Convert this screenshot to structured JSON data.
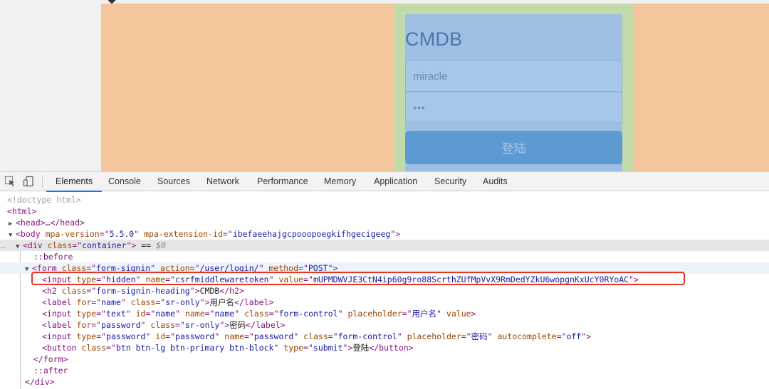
{
  "page": {
    "heading": "CMDB",
    "username_value": "miracle",
    "password_value": "•••",
    "login_button": "登陆"
  },
  "devtools": {
    "tabs": [
      {
        "label": "Elements",
        "active": true
      },
      {
        "label": "Console"
      },
      {
        "label": "Sources"
      },
      {
        "label": "Network"
      },
      {
        "label": "Performance"
      },
      {
        "label": "Memory"
      },
      {
        "label": "Application"
      },
      {
        "label": "Security"
      },
      {
        "label": "Audits"
      }
    ],
    "icons": {
      "inspect": "inspect-element-icon",
      "device": "device-toolbar-icon"
    },
    "dom": {
      "doctype": "<!doctype html>",
      "html_open": "<html>",
      "head": "<head>…</head>",
      "body": {
        "tag": "body",
        "attrs": [
          [
            "mpa-version",
            "5.5.0"
          ],
          [
            "mpa-extension-id",
            "ibefaeehajgcpooopoegkifhgecigeeg"
          ]
        ]
      },
      "div": {
        "tag": "div",
        "attrs": [
          [
            "class",
            "container"
          ]
        ],
        "suffix": " == ",
        "dollar": "$0"
      },
      "before": "::before",
      "form": {
        "tag": "form",
        "attrs": [
          [
            "class",
            "form-signin"
          ],
          [
            "action",
            "/user/login/"
          ],
          [
            "method",
            "POST"
          ]
        ]
      },
      "hidden_input": {
        "tag": "input",
        "attrs": [
          [
            "type",
            "hidden"
          ],
          [
            "name",
            "csrfmiddlewaretoken"
          ],
          [
            "value",
            "mUPMDWVJE3CtN4ip60g9ro88ScrthZUfMpVvX9RmDedYZkU6wopgnKxUcY0RYoAC"
          ]
        ]
      },
      "h2": {
        "tag": "h2",
        "attrs": [
          [
            "class",
            "form-signin-heading"
          ]
        ],
        "text": "CMDB"
      },
      "label_name": {
        "tag": "label",
        "attrs": [
          [
            "for",
            "name"
          ],
          [
            "class",
            "sr-only"
          ]
        ],
        "text": "用户名"
      },
      "input_text": {
        "tag": "input",
        "attrs": [
          [
            "type",
            "text"
          ],
          [
            "id",
            "name"
          ],
          [
            "name",
            "name"
          ],
          [
            "class",
            "form-control"
          ],
          [
            "placeholder",
            "用户名"
          ]
        ],
        "bare_attr": "value"
      },
      "label_password": {
        "tag": "label",
        "attrs": [
          [
            "for",
            "password"
          ],
          [
            "class",
            "sr-only"
          ]
        ],
        "text": "密码"
      },
      "input_password": {
        "tag": "input",
        "attrs": [
          [
            "type",
            "password"
          ],
          [
            "id",
            "password"
          ],
          [
            "name",
            "password"
          ],
          [
            "class",
            "form-control"
          ],
          [
            "placeholder",
            "密码"
          ],
          [
            "autocomplete",
            "off"
          ]
        ]
      },
      "button": {
        "tag": "button",
        "attrs": [
          [
            "class",
            "btn btn-lg btn-primary btn-block"
          ],
          [
            "type",
            "submit"
          ]
        ],
        "text": "登陆"
      },
      "form_close": "</form>",
      "after": "::after",
      "div_close": "</div>"
    }
  },
  "colors": {
    "body_overlay": "#f3c79b",
    "container_overlay": "#c2d9a9",
    "form_overlay": "#9ebfe3",
    "highlight_box": "#e8351f",
    "active_tab": "#1a73e8"
  }
}
